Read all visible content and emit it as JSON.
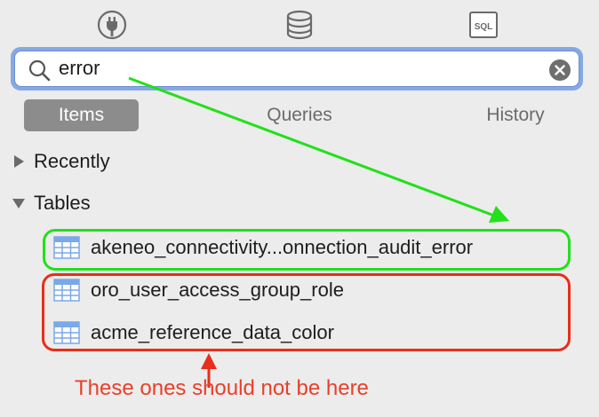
{
  "toolbar": {
    "icons": [
      "plug-icon",
      "database-icon",
      "sql-icon"
    ],
    "sql_label": "SQL"
  },
  "search": {
    "value": "error",
    "placeholder": ""
  },
  "segments": {
    "items": "Items",
    "queries": "Queries",
    "history": "History",
    "selected": "Items"
  },
  "groups": {
    "recently": "Recently",
    "tables": "Tables"
  },
  "tables": [
    "akeneo_connectivity...onnection_audit_error",
    "oro_user_access_group_role",
    "acme_reference_data_color"
  ],
  "annotation": {
    "note": "These ones should not be here",
    "green": "#22e01a",
    "red": "#e82e1a"
  }
}
